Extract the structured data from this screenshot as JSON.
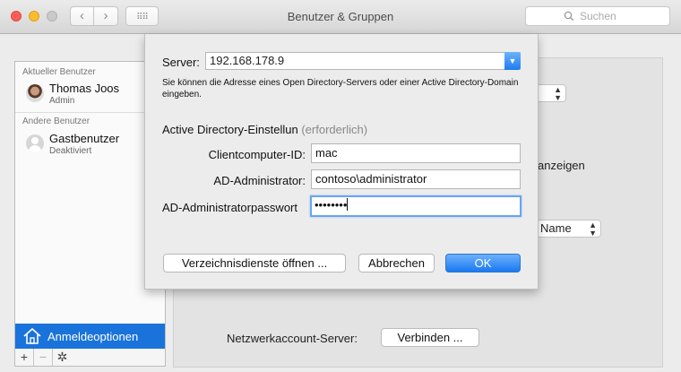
{
  "window": {
    "title": "Benutzer & Gruppen"
  },
  "toolbar": {
    "back": "‹",
    "forward": "›",
    "grid": "⠿⠿",
    "search_placeholder": "Suchen"
  },
  "sidebar": {
    "current_header": "Aktueller Benutzer",
    "other_header": "Andere Benutzer",
    "users": [
      {
        "name": "Thomas Joos",
        "role": "Admin"
      },
      {
        "name": "Gastbenutzer",
        "role": "Deaktiviert"
      }
    ],
    "login_options": "Anmeldeoptionen",
    "add": "+",
    "remove": "−",
    "settings": "✲"
  },
  "background": {
    "show_text": "anzeigen",
    "name_popup": "Name",
    "network_server_label": "Netzwerkaccount-Server:",
    "connect_button": "Verbinden ..."
  },
  "sheet": {
    "server_label": "Server:",
    "server_value": "192.168.178.9",
    "hint": "Sie können die Adresse eines Open Directory-Servers oder einer Active Directory-Domain eingeben.",
    "section_title": "Active Directory-Einstellun",
    "section_required": "(erforderlich)",
    "client_label": "Clientcomputer-ID:",
    "client_value": "mac",
    "admin_label": "AD-Administrator:",
    "admin_value": "contoso\\administrator",
    "password_label": "AD-Administratorpasswort",
    "password_value": "••••••••",
    "open_dir_button": "Verzeichnisdienste öffnen ...",
    "cancel_button": "Abbrechen",
    "ok_button": "OK"
  },
  "colors": {
    "accent": "#1a78f2",
    "selection": "#1a73db"
  }
}
